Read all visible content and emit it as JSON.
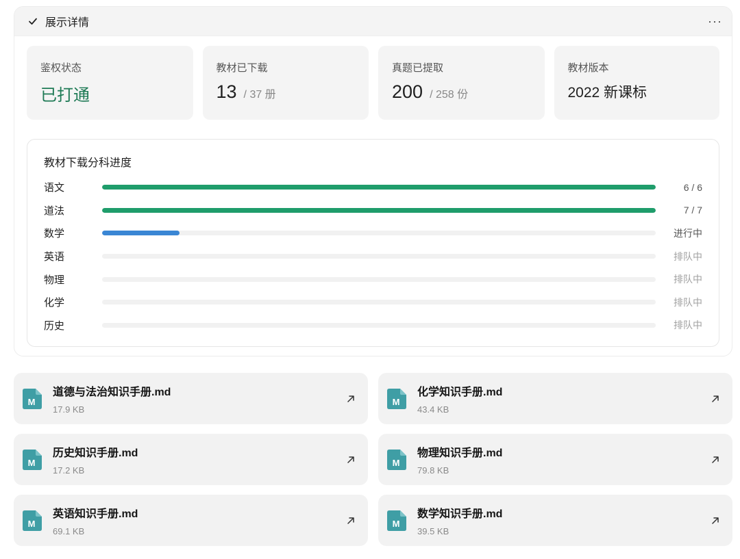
{
  "header": {
    "title": "展示详情",
    "check_icon": "check-icon",
    "more_icon": "more-horizontal-icon",
    "more_glyph": "···"
  },
  "stats": [
    {
      "label": "鉴权状态",
      "value": "已打通",
      "sub": ""
    },
    {
      "label": "教材已下载",
      "value": "13",
      "sub": "/ 37 册"
    },
    {
      "label": "真题已提取",
      "value": "200",
      "sub": "/ 258 份"
    },
    {
      "label": "教材版本",
      "value": "2022 新课标",
      "sub": ""
    }
  ],
  "progress": {
    "title": "教材下载分科进度",
    "rows": [
      {
        "label": "语文",
        "status": "6 / 6",
        "fill": 1.0,
        "color": "#1f9d6b"
      },
      {
        "label": "道法",
        "status": "7 / 7",
        "fill": 1.0,
        "color": "#1f9d6b"
      },
      {
        "label": "数学",
        "status": "进行中",
        "fill": 0.14,
        "color": "#3a86d4"
      },
      {
        "label": "英语",
        "status": "排队中",
        "fill": 0,
        "color": "#f1f1f1"
      },
      {
        "label": "物理",
        "status": "排队中",
        "fill": 0,
        "color": "#f1f1f1"
      },
      {
        "label": "化学",
        "status": "排队中",
        "fill": 0,
        "color": "#f1f1f1"
      },
      {
        "label": "历史",
        "status": "排队中",
        "fill": 0,
        "color": "#f1f1f1"
      }
    ]
  },
  "files": [
    {
      "name": "道德与法治知识手册.md",
      "size": "17.9 KB"
    },
    {
      "name": "化学知识手册.md",
      "size": "43.4 KB"
    },
    {
      "name": "历史知识手册.md",
      "size": "17.2 KB"
    },
    {
      "name": "物理知识手册.md",
      "size": "79.8 KB"
    },
    {
      "name": "英语知识手册.md",
      "size": "69.1 KB"
    },
    {
      "name": "数学知识手册.md",
      "size": "39.5 KB"
    }
  ],
  "colors": {
    "accent_green": "#1f9d6b",
    "status_green_text": "#1e7a55",
    "accent_blue": "#3a86d4",
    "file_icon": "#3f9ea5"
  },
  "icons": {
    "file_icon": "markdown-file-icon",
    "open_icon": "arrow-up-right-icon",
    "file_icon_letter": "M"
  }
}
